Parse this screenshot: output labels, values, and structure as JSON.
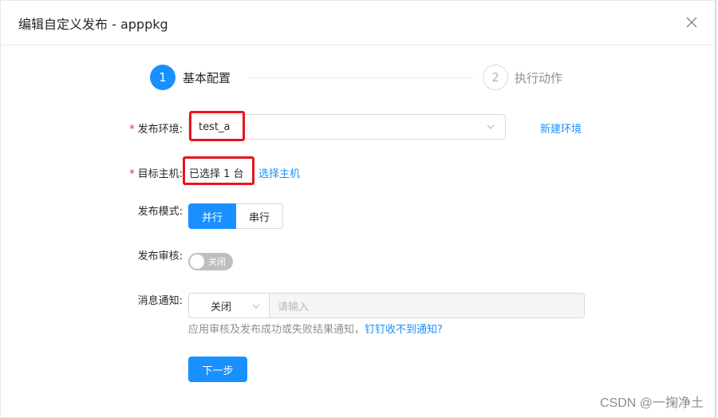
{
  "modal": {
    "title": "编辑自定义发布 - apppkg",
    "close_icon": "close-icon"
  },
  "steps": [
    {
      "number": "1",
      "label": "基本配置",
      "status": "active"
    },
    {
      "number": "2",
      "label": "执行动作",
      "status": "wait"
    }
  ],
  "form": {
    "env": {
      "label": "发布环境:",
      "required": true,
      "value": "test_a",
      "link": "新建环境"
    },
    "host": {
      "label": "目标主机:",
      "required": true,
      "value": "已选择 1 台",
      "link": "选择主机"
    },
    "mode": {
      "label": "发布模式:",
      "options": [
        "并行",
        "串行"
      ],
      "selected": "并行"
    },
    "review": {
      "label": "发布审核:",
      "switch_text": "关闭",
      "on": false
    },
    "notify": {
      "label": "消息通知:",
      "select_value": "关闭",
      "input_placeholder": "请输入",
      "help_text": "应用审核及发布成功或失败结果通知，",
      "help_link": "钉钉收不到通知?"
    },
    "next_button": "下一步"
  },
  "colors": {
    "primary": "#1890ff",
    "required": "#f5222d",
    "highlight": "#e8141c"
  },
  "watermark": "CSDN @一掬净土"
}
